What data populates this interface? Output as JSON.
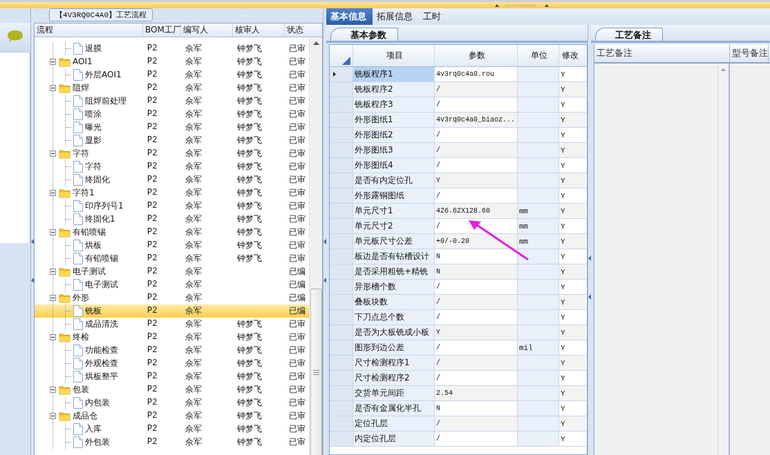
{
  "tree_panel": {
    "title": "【4V3RQ0C4A0】工艺流程",
    "columns": [
      "流程",
      "BOM工厂",
      "编写人",
      "核审人",
      "状态"
    ],
    "groups": [
      {
        "children": [
          {
            "label": "退膜",
            "bom": "P2",
            "writer": "佘军",
            "reviewer": "钟梦飞",
            "status": "已审",
            "selected": false
          }
        ]
      },
      {
        "label": "AOI1",
        "bom": "P2",
        "writer": "佘军",
        "reviewer": "钟梦飞",
        "status": "已审",
        "selected": false,
        "expanded": true,
        "children": [
          {
            "label": "外层AOI1",
            "bom": "P2",
            "writer": "佘军",
            "reviewer": "钟梦飞",
            "status": "已审",
            "selected": false
          }
        ]
      },
      {
        "label": "阻焊",
        "bom": "P2",
        "writer": "佘军",
        "reviewer": "钟梦飞",
        "status": "已审",
        "selected": false,
        "expanded": true,
        "children": [
          {
            "label": "阻焊前处理",
            "bom": "P2",
            "writer": "佘军",
            "reviewer": "钟梦飞",
            "status": "已审",
            "selected": false
          },
          {
            "label": "喷涂",
            "bom": "P2",
            "writer": "佘军",
            "reviewer": "钟梦飞",
            "status": "已审",
            "selected": false
          },
          {
            "label": "曝光",
            "bom": "P2",
            "writer": "佘军",
            "reviewer": "钟梦飞",
            "status": "已审",
            "selected": false
          },
          {
            "label": "显影",
            "bom": "P2",
            "writer": "佘军",
            "reviewer": "钟梦飞",
            "status": "已审",
            "selected": false
          }
        ]
      },
      {
        "label": "字符",
        "bom": "P2",
        "writer": "佘军",
        "reviewer": "钟梦飞",
        "status": "已审",
        "selected": false,
        "expanded": true,
        "children": [
          {
            "label": "字符",
            "bom": "P2",
            "writer": "佘军",
            "reviewer": "钟梦飞",
            "status": "已审",
            "selected": false
          },
          {
            "label": "终固化",
            "bom": "P2",
            "writer": "佘军",
            "reviewer": "钟梦飞",
            "status": "已审",
            "selected": false
          }
        ]
      },
      {
        "label": "字符1",
        "bom": "P2",
        "writer": "佘军",
        "reviewer": "钟梦飞",
        "status": "已审",
        "selected": false,
        "expanded": true,
        "children": [
          {
            "label": "印序列号1",
            "bom": "P2",
            "writer": "佘军",
            "reviewer": "钟梦飞",
            "status": "已审",
            "selected": false
          },
          {
            "label": "终固化1",
            "bom": "P2",
            "writer": "佘军",
            "reviewer": "钟梦飞",
            "status": "已审",
            "selected": false
          }
        ]
      },
      {
        "label": "有铅喷锡",
        "bom": "P2",
        "writer": "佘军",
        "reviewer": "钟梦飞",
        "status": "已审",
        "selected": false,
        "expanded": true,
        "children": [
          {
            "label": "烘板",
            "bom": "P2",
            "writer": "佘军",
            "reviewer": "钟梦飞",
            "status": "已审",
            "selected": false
          },
          {
            "label": "有铅喷锡",
            "bom": "P2",
            "writer": "佘军",
            "reviewer": "钟梦飞",
            "status": "已审",
            "selected": false
          }
        ]
      },
      {
        "label": "电子测试",
        "bom": "P2",
        "writer": "佘军",
        "status": "已编",
        "selected": false,
        "expanded": true,
        "children": [
          {
            "label": "电子测试",
            "bom": "P2",
            "writer": "佘军",
            "status": "已编",
            "selected": false
          }
        ]
      },
      {
        "label": "外形",
        "bom": "P2",
        "writer": "佘军",
        "status": "已编",
        "selected": false,
        "expanded": true,
        "children": [
          {
            "label": "铣板",
            "bom": "P2",
            "writer": "佘军",
            "status": "已编",
            "selected": true
          },
          {
            "label": "成品清洗",
            "bom": "P2",
            "writer": "佘军",
            "reviewer": "钟梦飞",
            "status": "已审",
            "selected": false
          }
        ]
      },
      {
        "label": "终检",
        "bom": "P2",
        "writer": "佘军",
        "reviewer": "钟梦飞",
        "status": "已审",
        "selected": false,
        "expanded": true,
        "children": [
          {
            "label": "功能检查",
            "bom": "P2",
            "writer": "佘军",
            "reviewer": "钟梦飞",
            "status": "已审",
            "selected": false
          },
          {
            "label": "外观检查",
            "bom": "P2",
            "writer": "佘军",
            "reviewer": "钟梦飞",
            "status": "已审",
            "selected": false
          },
          {
            "label": "烘板整平",
            "bom": "P2",
            "writer": "佘军",
            "reviewer": "钟梦飞",
            "status": "已审",
            "selected": false
          }
        ]
      },
      {
        "label": "包装",
        "bom": "P2",
        "writer": "佘军",
        "reviewer": "钟梦飞",
        "status": "已审",
        "selected": false,
        "expanded": true,
        "children": [
          {
            "label": "内包装",
            "bom": "P2",
            "writer": "佘军",
            "reviewer": "钟梦飞",
            "status": "已审",
            "selected": false
          }
        ]
      },
      {
        "label": "成品仓",
        "bom": "P2",
        "writer": "佘军",
        "reviewer": "钟梦飞",
        "status": "已审",
        "selected": false,
        "expanded": true,
        "children": [
          {
            "label": "入库",
            "bom": "P2",
            "writer": "佘军",
            "reviewer": "钟梦飞",
            "status": "已审",
            "selected": false
          },
          {
            "label": "外包装",
            "bom": "P2",
            "writer": "佘军",
            "reviewer": "钟梦飞",
            "status": "已审",
            "selected": false
          }
        ]
      }
    ]
  },
  "top_tabs": [
    {
      "label": "基本信息",
      "selected": true
    },
    {
      "label": "拓展信息",
      "selected": false
    },
    {
      "label": "工时",
      "selected": false
    }
  ],
  "params_panel": {
    "tab": "基本参数",
    "columns": [
      "项目",
      "参数",
      "单位",
      "修改"
    ],
    "rows": [
      {
        "item": "铣板程序1",
        "value": "4v3rq0c4a0.rou",
        "modify": "Y",
        "selected": true
      },
      {
        "item": "铣板程序2",
        "value": "/",
        "modify": "Y",
        "selected": false
      },
      {
        "item": "铣板程序3",
        "value": "/",
        "modify": "Y",
        "selected": false
      },
      {
        "item": "外形图纸1",
        "value": "4v3rq0c4a0_biaoz...",
        "modify": "Y",
        "selected": false
      },
      {
        "item": "外形图纸2",
        "value": "/",
        "modify": "Y",
        "selected": false
      },
      {
        "item": "外形图纸3",
        "value": "/",
        "modify": "Y",
        "selected": false
      },
      {
        "item": "外形图纸4",
        "value": "/",
        "modify": "Y",
        "selected": false
      },
      {
        "item": "是否有内定位孔",
        "value": "Y",
        "modify": "Y",
        "selected": false
      },
      {
        "item": "外形露铜图纸",
        "value": "/",
        "modify": "Y",
        "selected": false
      },
      {
        "item": "单元尺寸1",
        "value": "426.62X128.60",
        "unit": "mm",
        "modify": "Y",
        "selected": false
      },
      {
        "item": "单元尺寸2",
        "value": "/",
        "unit": "mm",
        "modify": "Y",
        "selected": false
      },
      {
        "item": "单元板尺寸公差",
        "value": "+0/-0.20",
        "unit": "mm",
        "modify": "Y",
        "selected": false
      },
      {
        "item": "板边是否有钻槽设计",
        "value": "N",
        "modify": "Y",
        "selected": false
      },
      {
        "item": "是否采用粗铣+精铣",
        "value": "N",
        "modify": "Y",
        "selected": false
      },
      {
        "item": "异形槽个数",
        "value": "/",
        "modify": "Y",
        "selected": false
      },
      {
        "item": "叠板块数",
        "value": "/",
        "modify": "Y",
        "selected": false
      },
      {
        "item": "下刀点总个数",
        "value": "/",
        "modify": "Y",
        "selected": false
      },
      {
        "item": "是否为大板铣成小板",
        "value": "Y",
        "modify": "Y",
        "selected": false
      },
      {
        "item": "图形到边公差",
        "value": "/",
        "unit": "mil",
        "modify": "Y",
        "selected": false
      },
      {
        "item": "尺寸检测程序1",
        "value": "/",
        "modify": "Y",
        "selected": false
      },
      {
        "item": "尺寸检测程序2",
        "value": "/",
        "modify": "Y",
        "selected": false
      },
      {
        "item": "交货单元间距",
        "value": "2.54",
        "modify": "Y",
        "selected": false
      },
      {
        "item": "是否有金属化半孔",
        "value": "N",
        "modify": "Y",
        "selected": false
      },
      {
        "item": "定位孔层",
        "value": "/",
        "modify": "Y",
        "selected": false
      },
      {
        "item": "内定位孔层",
        "value": "/",
        "modify": "Y",
        "selected": false
      }
    ]
  },
  "notes_panel": {
    "tab": "工艺备注",
    "columns": [
      "工艺备注",
      "型号备注"
    ]
  }
}
